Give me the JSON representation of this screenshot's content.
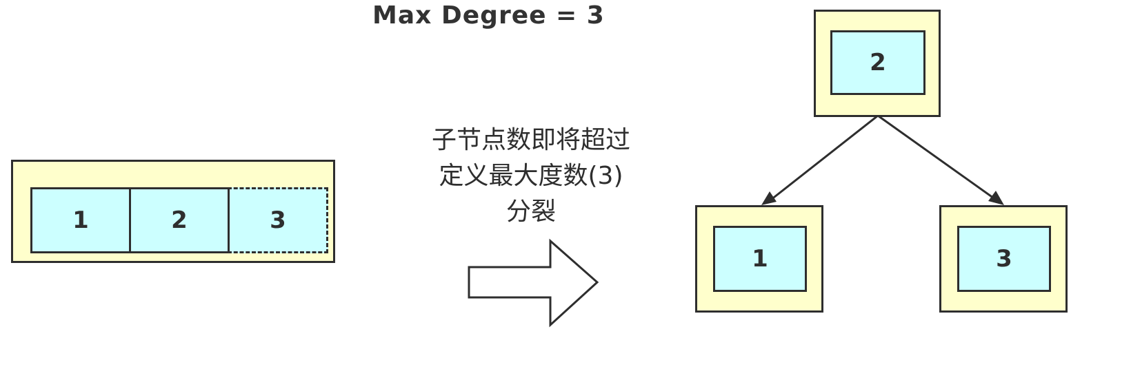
{
  "title": "Max Degree = 3",
  "before": {
    "cells": [
      "1",
      "2",
      "3"
    ]
  },
  "caption": {
    "line1": "子节点数即将超过",
    "line2": "定义最大度数(3)",
    "line3": "分裂"
  },
  "after": {
    "root": "2",
    "left_child": "1",
    "right_child": "3"
  },
  "colors": {
    "outer_fill": "#ffffcc",
    "inner_fill": "#ccffff",
    "stroke": "#2e2e2e"
  }
}
